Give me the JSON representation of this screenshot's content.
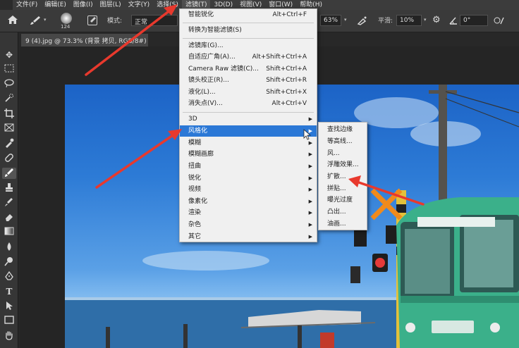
{
  "menubar": {
    "items": [
      "文件(F)",
      "编辑(E)",
      "图像(I)",
      "图层(L)",
      "文字(Y)",
      "选择(S)",
      "滤镜(T)",
      "3D(D)",
      "视图(V)",
      "窗口(W)",
      "帮助(H)"
    ],
    "active_index": 6
  },
  "options": {
    "brush_size": "124",
    "mode_label": "模式:",
    "mode_value": "正常",
    "flow_value": "63%",
    "smoothing_label": "平滑:",
    "smoothing_value": "10%",
    "angle_value": "0°"
  },
  "document_tab": {
    "title": "9 (4).jpg @ 73.3% (背景 拷贝, RGB/8#)"
  },
  "filter_menu": {
    "items": [
      {
        "label": "智能锐化",
        "shortcut": "Alt+Ctrl+F"
      },
      {
        "label": "转换为智能滤镜(S)",
        "shortcut": ""
      },
      {
        "label": "滤镜库(G)...",
        "shortcut": ""
      },
      {
        "label": "自适应广角(A)...",
        "shortcut": "Alt+Shift+Ctrl+A"
      },
      {
        "label": "Camera Raw 滤镜(C)...",
        "shortcut": "Shift+Ctrl+A"
      },
      {
        "label": "镜头校正(R)...",
        "shortcut": "Shift+Ctrl+R"
      },
      {
        "label": "液化(L)...",
        "shortcut": "Shift+Ctrl+X"
      },
      {
        "label": "消失点(V)...",
        "shortcut": "Alt+Ctrl+V"
      },
      {
        "label": "3D",
        "shortcut": ""
      },
      {
        "label": "风格化",
        "shortcut": ""
      },
      {
        "label": "模糊",
        "shortcut": ""
      },
      {
        "label": "模糊画廊",
        "shortcut": ""
      },
      {
        "label": "扭曲",
        "shortcut": ""
      },
      {
        "label": "锐化",
        "shortcut": ""
      },
      {
        "label": "视频",
        "shortcut": ""
      },
      {
        "label": "像素化",
        "shortcut": ""
      },
      {
        "label": "渲染",
        "shortcut": ""
      },
      {
        "label": "杂色",
        "shortcut": ""
      },
      {
        "label": "其它",
        "shortcut": ""
      }
    ]
  },
  "stylize_submenu": {
    "items": [
      "查找边缘",
      "等高线...",
      "风...",
      "浮雕效果...",
      "扩散...",
      "拼贴...",
      "曝光过度",
      "凸出...",
      "油画..."
    ]
  },
  "colors": {
    "menu_highlight": "#2b78d6",
    "arrow": "#e8392d",
    "tram_green": "#3bb08a"
  }
}
